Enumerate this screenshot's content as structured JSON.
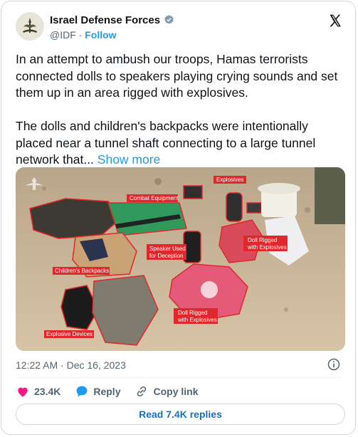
{
  "author": {
    "name": "Israel Defense Forces",
    "handle": "@IDF",
    "separator": "·",
    "follow_label": "Follow"
  },
  "tweet": {
    "paragraph1": "In an attempt to ambush our troops, Hamas terrorists connected dolls to speakers playing crying sounds and set them up in an area rigged with explosives.",
    "paragraph2": "The dolls and children's backpacks were intentionally placed near a tunnel shaft connecting to a large tunnel network that...",
    "show_more": "Show more"
  },
  "photo": {
    "labels": {
      "combat_equipment": "Combat Equipment",
      "explosives": "Explosives",
      "speaker": "Speaker Used",
      "speaker2": "for Deception",
      "doll1a": "Doll Rigged",
      "doll1b": "with Explosives",
      "backpacks": "Children's Backpacks",
      "doll2a": "Doll Rigged",
      "doll2b": "with Explosives",
      "explosive_devices": "Explosive Devices"
    }
  },
  "meta": {
    "timestamp": "12:22 AM · Dec 16, 2023"
  },
  "actions": {
    "likes": "23.4K",
    "reply": "Reply",
    "copy_link": "Copy link"
  },
  "replies_button": "Read 7.4K replies",
  "colors": {
    "accent": "#1d9bf0",
    "like": "#f91880",
    "reply": "#1d9bf0",
    "label_bg": "#e0272b"
  },
  "icons": [
    "idf-logo-icon",
    "verified-badge-icon",
    "x-logo-icon",
    "info-icon",
    "heart-icon",
    "reply-bubble-icon",
    "link-icon"
  ]
}
